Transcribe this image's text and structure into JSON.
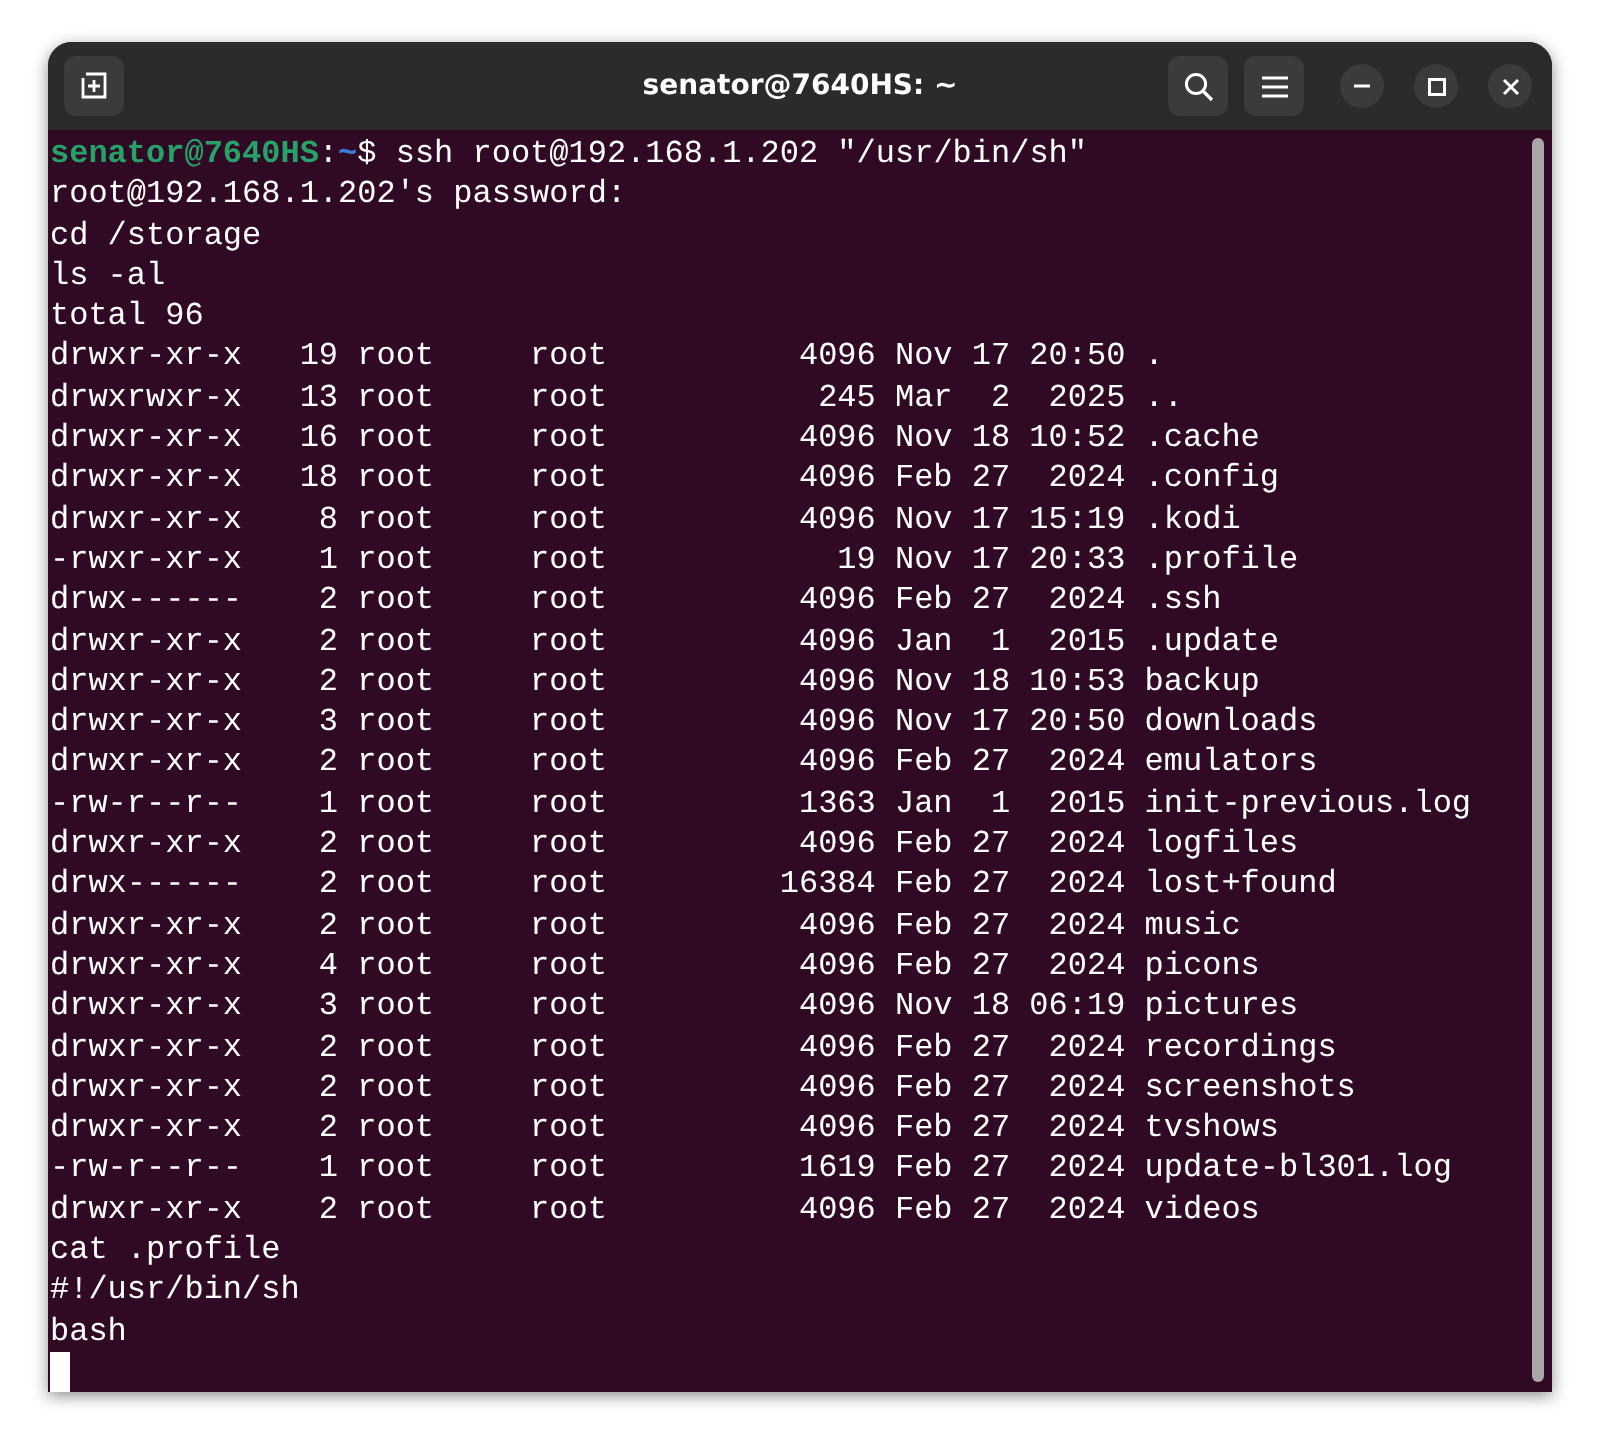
{
  "window": {
    "title": "senator@7640HS: ~"
  },
  "terminal": {
    "lines": [
      {
        "kind": "prompt",
        "segments": [
          {
            "kind": "user",
            "text": "senator@7640HS"
          },
          {
            "kind": "plain",
            "text": ":"
          },
          {
            "kind": "path",
            "text": "~"
          },
          {
            "kind": "plain",
            "text": "$ ssh root@192.168.1.202 \"/usr/bin/sh\""
          }
        ]
      },
      {
        "kind": "output",
        "text": "root@192.168.1.202's password:"
      },
      {
        "kind": "output",
        "text": "cd /storage"
      },
      {
        "kind": "output",
        "text": "ls -al"
      },
      {
        "kind": "output",
        "text": "total 96"
      },
      {
        "kind": "output",
        "text": "drwxr-xr-x   19 root     root          4096 Nov 17 20:50 ."
      },
      {
        "kind": "output",
        "text": "drwxrwxr-x   13 root     root           245 Mar  2  2025 .."
      },
      {
        "kind": "output",
        "text": "drwxr-xr-x   16 root     root          4096 Nov 18 10:52 .cache"
      },
      {
        "kind": "output",
        "text": "drwxr-xr-x   18 root     root          4096 Feb 27  2024 .config"
      },
      {
        "kind": "output",
        "text": "drwxr-xr-x    8 root     root          4096 Nov 17 15:19 .kodi"
      },
      {
        "kind": "output",
        "text": "-rwxr-xr-x    1 root     root            19 Nov 17 20:33 .profile"
      },
      {
        "kind": "output",
        "text": "drwx------    2 root     root          4096 Feb 27  2024 .ssh"
      },
      {
        "kind": "output",
        "text": "drwxr-xr-x    2 root     root          4096 Jan  1  2015 .update"
      },
      {
        "kind": "output",
        "text": "drwxr-xr-x    2 root     root          4096 Nov 18 10:53 backup"
      },
      {
        "kind": "output",
        "text": "drwxr-xr-x    3 root     root          4096 Nov 17 20:50 downloads"
      },
      {
        "kind": "output",
        "text": "drwxr-xr-x    2 root     root          4096 Feb 27  2024 emulators"
      },
      {
        "kind": "output",
        "text": "-rw-r--r--    1 root     root          1363 Jan  1  2015 init-previous.log"
      },
      {
        "kind": "output",
        "text": "drwxr-xr-x    2 root     root          4096 Feb 27  2024 logfiles"
      },
      {
        "kind": "output",
        "text": "drwx------    2 root     root         16384 Feb 27  2024 lost+found"
      },
      {
        "kind": "output",
        "text": "drwxr-xr-x    2 root     root          4096 Feb 27  2024 music"
      },
      {
        "kind": "output",
        "text": "drwxr-xr-x    4 root     root          4096 Feb 27  2024 picons"
      },
      {
        "kind": "output",
        "text": "drwxr-xr-x    3 root     root          4096 Nov 18 06:19 pictures"
      },
      {
        "kind": "output",
        "text": "drwxr-xr-x    2 root     root          4096 Feb 27  2024 recordings"
      },
      {
        "kind": "output",
        "text": "drwxr-xr-x    2 root     root          4096 Feb 27  2024 screenshots"
      },
      {
        "kind": "output",
        "text": "drwxr-xr-x    2 root     root          4096 Feb 27  2024 tvshows"
      },
      {
        "kind": "output",
        "text": "-rw-r--r--    1 root     root          1619 Feb 27  2024 update-bl301.log"
      },
      {
        "kind": "output",
        "text": "drwxr-xr-x    2 root     root          4096 Feb 27  2024 videos"
      },
      {
        "kind": "output",
        "text": "cat .profile"
      },
      {
        "kind": "output",
        "text": "#!/usr/bin/sh"
      },
      {
        "kind": "output",
        "text": "bash"
      }
    ]
  }
}
